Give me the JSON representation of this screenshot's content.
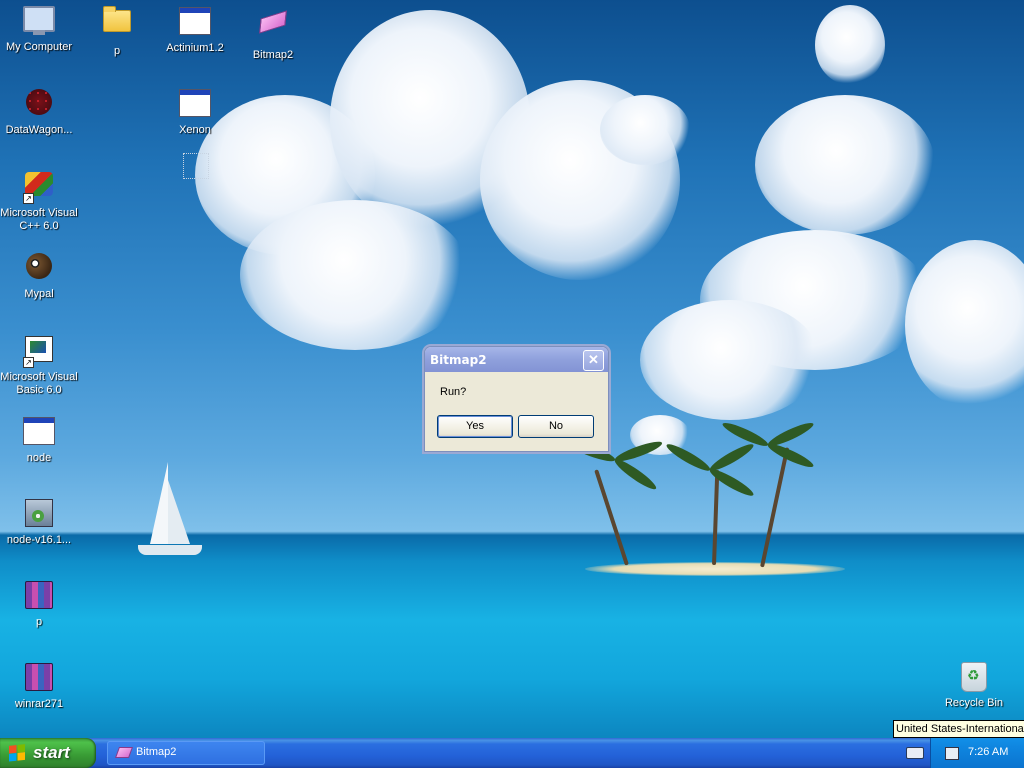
{
  "desktop": {
    "icons": [
      {
        "label": "My Computer",
        "icon": "computer-icon"
      },
      {
        "label": "p",
        "icon": "folder-icon"
      },
      {
        "label": "Actinium1.2",
        "icon": "window-app-icon"
      },
      {
        "label": "Bitmap2",
        "icon": "eraser-icon"
      },
      {
        "label": "DataWagon...",
        "icon": "datawagon-icon"
      },
      {
        "label": "Xenon",
        "icon": "window-app-icon"
      },
      {
        "label": "Microsoft Visual\nC++ 6.0",
        "icon": "visual-cpp-icon"
      },
      {
        "label": "Mypal",
        "icon": "mypal-icon"
      },
      {
        "label": "Microsoft Visual\nBasic 6.0",
        "icon": "visual-basic-icon"
      },
      {
        "label": "node",
        "icon": "window-app-icon"
      },
      {
        "label": "node-v16.1...",
        "icon": "installer-icon"
      },
      {
        "label": "p",
        "icon": "winrar-icon"
      },
      {
        "label": "winrar271",
        "icon": "winrar-icon"
      },
      {
        "label": "Recycle Bin",
        "icon": "recycle-bin-icon"
      }
    ]
  },
  "dialog": {
    "title": "Bitmap2",
    "close_glyph": "✕",
    "message": "Run?",
    "yes_label": "Yes",
    "no_label": "No"
  },
  "taskbar": {
    "start_label": "start",
    "task_button_label": "Bitmap2",
    "clock": "7:26 AM",
    "tooltip": "United States-International"
  },
  "colors": {
    "taskbar_blue": "#2361d8",
    "start_green": "#3c9b3c",
    "dialog_face": "#ece9d8",
    "dialog_title": "#8fa0dc"
  }
}
